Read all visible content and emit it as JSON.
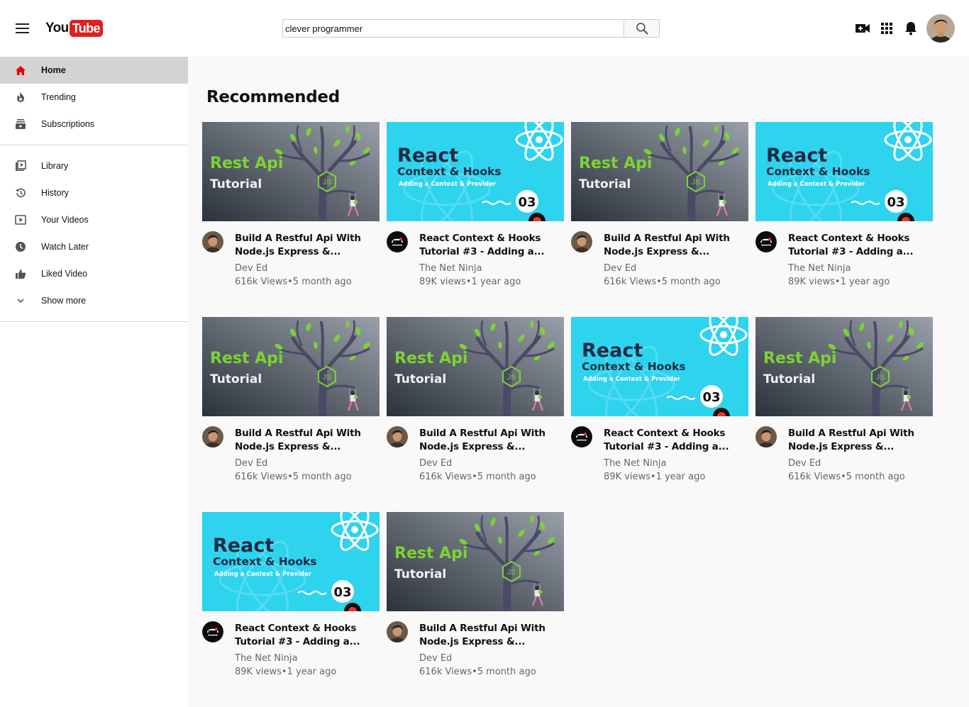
{
  "header": {
    "logo_you": "You",
    "logo_tube": "Tube",
    "search_value": "clever programmer"
  },
  "sidebar": {
    "primary": [
      {
        "label": "Home",
        "icon": "home-icon",
        "active": true
      },
      {
        "label": "Trending",
        "icon": "trending-icon"
      },
      {
        "label": "Subscriptions",
        "icon": "subscriptions-icon"
      }
    ],
    "secondary": [
      {
        "label": "Library",
        "icon": "library-icon"
      },
      {
        "label": "History",
        "icon": "history-icon"
      },
      {
        "label": "Your Videos",
        "icon": "your-videos-icon"
      },
      {
        "label": "Watch Later",
        "icon": "watch-later-icon"
      },
      {
        "label": "Liked Video",
        "icon": "liked-video-icon"
      },
      {
        "label": "Show more",
        "icon": "chevron-down-icon"
      }
    ]
  },
  "main": {
    "title": "Recommended",
    "thumb_text": {
      "rest_title": "Rest Api",
      "rest_sub": "Tutorial",
      "react_title": "React",
      "react_sub": "Context & Hooks",
      "react_caption": "Adding a Context & Provider",
      "react_number": "03",
      "js_badge": "JS"
    },
    "videos": [
      {
        "type": "rest",
        "title_l1": "Build A Restful Api With",
        "title_l2": "Node.js Express &...",
        "channel": "Dev Ed",
        "meta": "616k Views•5 month ago"
      },
      {
        "type": "react",
        "title_l1": "React Context & Hooks",
        "title_l2": "Tutorial #3 - Adding a...",
        "channel": "The Net Ninja",
        "meta": "89K views•1 year ago"
      },
      {
        "type": "rest",
        "title_l1": "Build A Restful Api With",
        "title_l2": "Node.js Express &...",
        "channel": "Dev Ed",
        "meta": "616k Views•5 month ago"
      },
      {
        "type": "react",
        "title_l1": "React Context & Hooks",
        "title_l2": "Tutorial #3 - Adding a...",
        "channel": "The Net Ninja",
        "meta": "89K views•1 year ago"
      },
      {
        "type": "rest",
        "title_l1": "Build A Restful Api With",
        "title_l2": "Node.js Express &...",
        "channel": "Dev Ed",
        "meta": "616k Views•5 month ago"
      },
      {
        "type": "rest",
        "title_l1": "Build A Restful Api With",
        "title_l2": "Node.js Express &...",
        "channel": "Dev Ed",
        "meta": "616k Views•5 month ago"
      },
      {
        "type": "react",
        "title_l1": "React Context & Hooks",
        "title_l2": "Tutorial #3 - Adding a...",
        "channel": "The Net Ninja",
        "meta": "89K views•1 year ago"
      },
      {
        "type": "rest",
        "title_l1": "Build A Restful Api With",
        "title_l2": "Node.js Express &...",
        "channel": "Dev Ed",
        "meta": "616k Views•5 month ago"
      },
      {
        "type": "react",
        "title_l1": "React Context & Hooks",
        "title_l2": "Tutorial #3 - Adding a...",
        "channel": "The Net Ninja",
        "meta": "89K views•1 year ago"
      },
      {
        "type": "rest",
        "title_l1": "Build A Restful Api With",
        "title_l2": "Node.js Express &...",
        "channel": "Dev Ed",
        "meta": "616k Views•5 month ago"
      }
    ]
  },
  "colors": {
    "brand_red": "#e02020",
    "rest_green": "#7dd332",
    "react_cyan": "#2ed3ee",
    "active_bg": "#d3d3d3"
  }
}
